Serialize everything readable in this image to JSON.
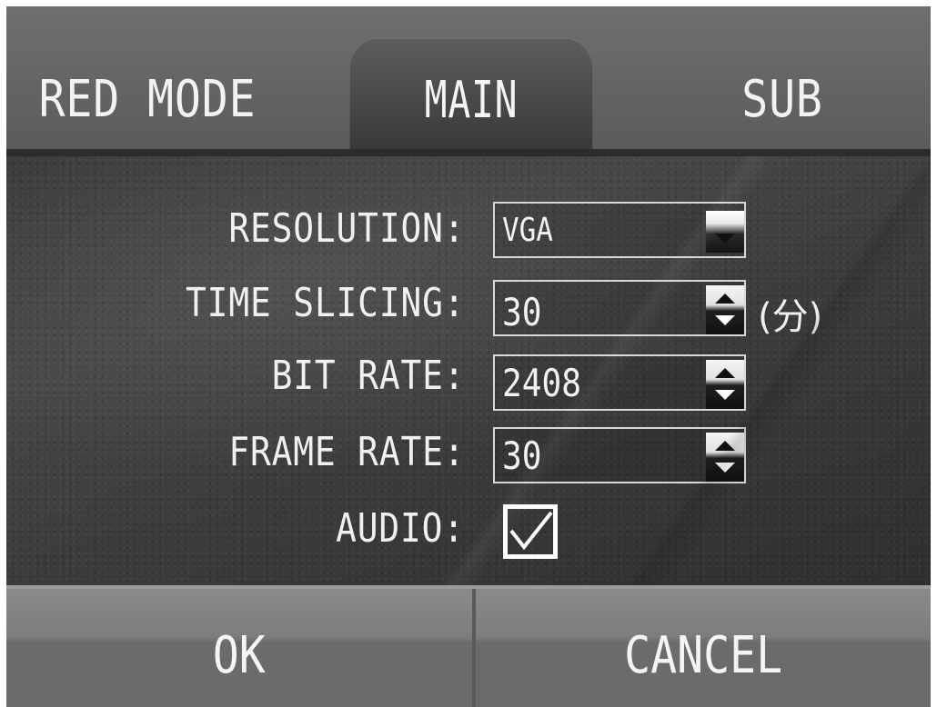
{
  "tabs": {
    "left": "RED MODE",
    "active": "MAIN",
    "right": "SUB"
  },
  "form": {
    "resolution_label": "RESOLUTION:",
    "resolution_value": "VGA",
    "time_slicing_label": "TIME SLICING:",
    "time_slicing_value": "30",
    "time_slicing_unit": "(分)",
    "bit_rate_label": "BIT RATE:",
    "bit_rate_value": "2408",
    "frame_rate_label": "FRAME RATE:",
    "frame_rate_value": "30",
    "audio_label": "AUDIO:",
    "audio_checked": true
  },
  "buttons": {
    "ok": "OK",
    "cancel": "CANCEL"
  },
  "icons": {
    "resolution_dropdown": "chevron-down-icon",
    "spinner": "up-down-spinner-icon",
    "audio_check": "check-icon"
  }
}
